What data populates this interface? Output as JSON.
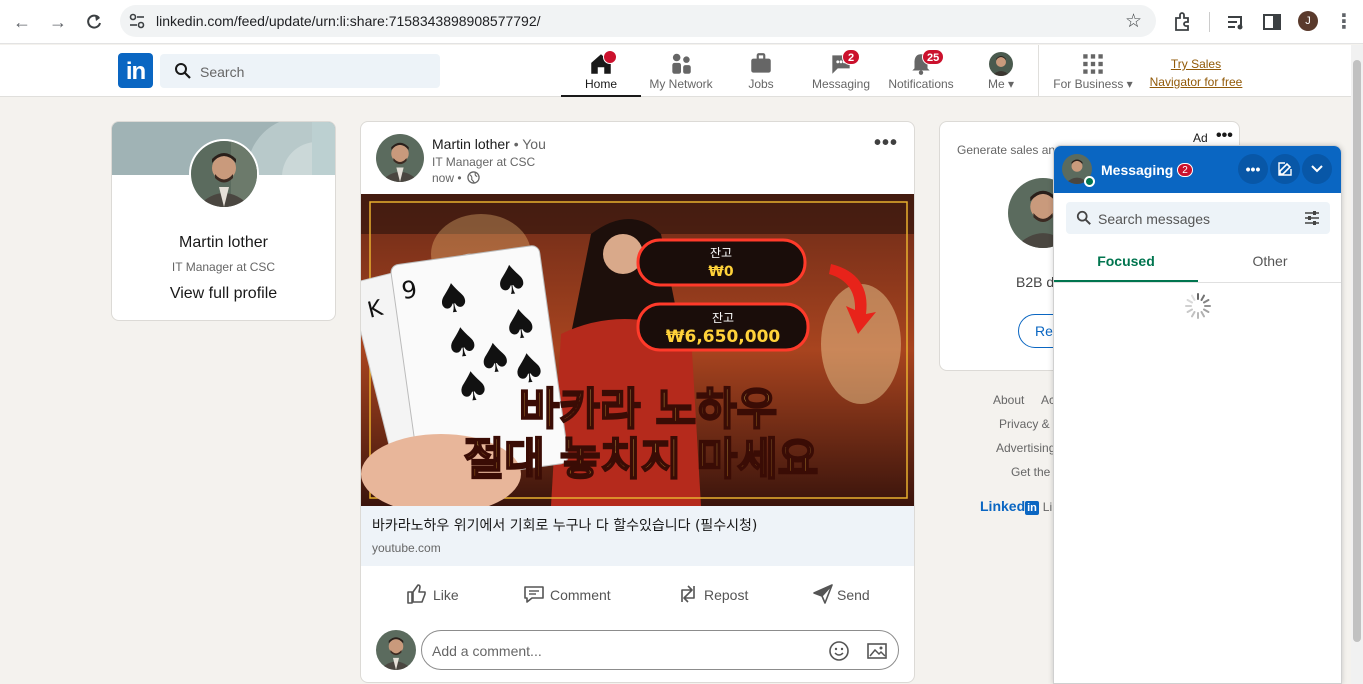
{
  "browser": {
    "url": "linkedin.com/feed/update/urn:li:share:7158343898908577792/",
    "profile_initial": "J"
  },
  "nav": {
    "search_placeholder": "Search",
    "items": [
      {
        "label": "Home",
        "badge": ""
      },
      {
        "label": "My Network",
        "badge": ""
      },
      {
        "label": "Jobs",
        "badge": ""
      },
      {
        "label": "Messaging",
        "badge": "2"
      },
      {
        "label": "Notifications",
        "badge": "25"
      },
      {
        "label": "Me",
        "badge": ""
      },
      {
        "label": "For Business",
        "badge": ""
      }
    ],
    "try_sales_line1": "Try Sales",
    "try_sales_line2": "Navigator for free"
  },
  "profile": {
    "name": "Martin lother",
    "headline": "IT Manager at CSC",
    "view_profile": "View full profile"
  },
  "post": {
    "author": "Martin lother",
    "you_tag": " • You",
    "headline": "IT Manager at CSC",
    "time": "now •",
    "thumbnail": {
      "balance_label_1": "잔고",
      "balance_value_1": "₩0",
      "balance_label_2": "잔고",
      "balance_value_2": "₩6,650,000",
      "headline_line1": "바카라 노하우",
      "headline_line2": "절대 놓치지 마세요",
      "card_rank": "9"
    },
    "link_title": "바카라노하우 위기에서 기회로 누구나 다 할수있습니다 (필수시청)",
    "link_domain": "youtube.com",
    "actions": {
      "like": "Like",
      "comment": "Comment",
      "repost": "Repost",
      "send": "Send"
    },
    "comment_placeholder": "Add a comment..."
  },
  "ad": {
    "label": "Ad",
    "generate_text": "Generate sales and",
    "b2b_text": "B2B d",
    "button": "Req"
  },
  "footer": {
    "about": "About",
    "ac": "Ac",
    "privacy": "Privacy &",
    "advertising": "Advertising",
    "get_the": "Get the",
    "logo_text": "Linked",
    "logo_in": "in",
    "li": "Li"
  },
  "messaging": {
    "title": "Messaging",
    "badge": "2",
    "search_placeholder": "Search messages",
    "tab_focused": "Focused",
    "tab_other": "Other"
  },
  "colors": {
    "brand": "#0a66c2",
    "badge": "#cb112d",
    "focused_green": "#01754f",
    "try_sales": "#915907"
  }
}
